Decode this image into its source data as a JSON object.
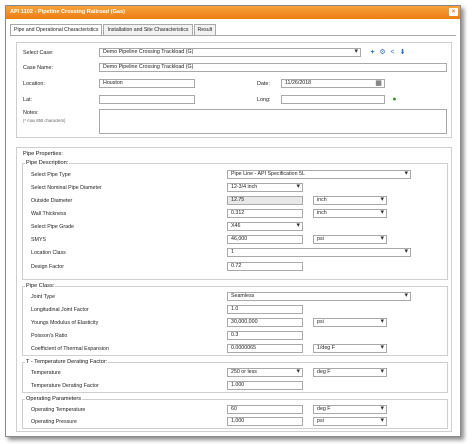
{
  "window": {
    "title": "API 1102 - Pipeline Crossing Railroad (Gas)",
    "close_glyph": "×",
    "accent": "#ef8a1f"
  },
  "tabs": [
    {
      "label": "Pipe and Operational Characteristics"
    },
    {
      "label": "Installation and Site Characteristics"
    },
    {
      "label": "Result"
    }
  ],
  "case": {
    "select_case_label": "Select Case:",
    "select_case_value": "Demo Pipeline Crossing Trackload (G)",
    "case_name_label": "Case Name:",
    "case_name_value": "Demo Pipeline Crossing Trackload (G)",
    "location_label": "Location:",
    "location_value": "Houston",
    "date_label": "Date:",
    "date_value": "11/26/2018",
    "lat_label": "Lat:",
    "lat_value": "",
    "long_label": "Long:",
    "long_value": "",
    "notes_label": "Notes:",
    "notes_hint": "(* max 850 characters)",
    "notes_value": ""
  },
  "pipe_properties": {
    "title": "Pipe Properties:",
    "description": {
      "title": "Pipe Description:",
      "pipe_type_label": "Select Pipe Type",
      "pipe_type_value": "Pipe Line - API Specification 5L",
      "diameter_label": "Select Nominal Pipe Diameter",
      "diameter_value": "12-3/4 inch",
      "outside_diameter_label": "Outside Diameter",
      "outside_diameter_value": "12.75",
      "outside_diameter_unit": "inch",
      "wall_thickness_label": "Wall Thickness",
      "wall_thickness_value": "0.312",
      "wall_thickness_unit": "inch",
      "grade_label": "Select Pipe Grade",
      "grade_value": "X46",
      "smys_label": "SMYS",
      "smys_value": "46,000",
      "smys_unit": "psi",
      "location_class_label": "Location Class",
      "location_class_value": "1",
      "design_factor_label": "Design Factor",
      "design_factor_value": "0.72"
    },
    "pipe_class": {
      "title": "Pipe Class:",
      "joint_type_label": "Joint Type",
      "joint_type_value": "Seamless",
      "longitudinal_label": "Longitudinal Joint Factor",
      "longitudinal_value": "1.0",
      "youngs_label": "Youngs Modulus of Elasticity",
      "youngs_value": "30,000,000",
      "youngs_unit": "psi",
      "poisson_label": "Poisson's Ratio",
      "poisson_value": "0.3",
      "thermal_label": "Coefficient of Thermal Expansion",
      "thermal_value": "0.0000065",
      "thermal_unit": "1/deg F"
    },
    "temperature": {
      "title": "T - Temperature Derating Factor:",
      "temperature_label": "Temperature",
      "temperature_value": "250 or less",
      "temperature_unit": "deg F",
      "derating_label": "Temperature Derating Factor",
      "derating_value": "1.000"
    },
    "operating": {
      "title": "Operating Parameters",
      "op_temp_label": "Operating Temperature",
      "op_temp_value": "60",
      "op_temp_unit": "deg F",
      "op_pressure_label": "Operating Pressure",
      "op_pressure_value": "1,000",
      "op_pressure_unit": "psi"
    }
  },
  "icons": {
    "add": "+",
    "settings": "⚙",
    "share": "<",
    "download": "⬇",
    "calendar": "▦",
    "map_marker": "●"
  }
}
